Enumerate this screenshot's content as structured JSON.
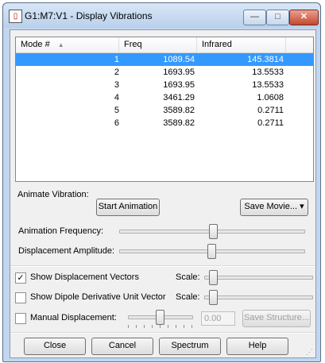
{
  "window": {
    "title": "G1:M7:V1 - Display Vibrations",
    "min_glyph": "—",
    "max_glyph": "□",
    "close_glyph": "✕"
  },
  "modes_table": {
    "columns": [
      "Mode #",
      "Freq",
      "Infrared"
    ],
    "sort_glyph": "▲",
    "selected_row": 0,
    "rows": [
      {
        "mode": "1",
        "freq": "1089.54",
        "ir": "145.3814"
      },
      {
        "mode": "2",
        "freq": "1693.95",
        "ir": "13.5533"
      },
      {
        "mode": "3",
        "freq": "1693.95",
        "ir": "13.5533"
      },
      {
        "mode": "4",
        "freq": "3461.29",
        "ir": "1.0608"
      },
      {
        "mode": "5",
        "freq": "3589.82",
        "ir": "0.2711"
      },
      {
        "mode": "6",
        "freq": "3589.82",
        "ir": "0.2711"
      }
    ]
  },
  "animate": {
    "label": "Animate Vibration:",
    "start_button": "Start Animation",
    "save_movie_button": "Save Movie...",
    "save_movie_glyph": "▾",
    "frequency_label": "Animation Frequency:",
    "frequency_level": 0.51,
    "amplitude_label": "Displacement Amplitude:",
    "amplitude_level": 0.5
  },
  "options": {
    "show_displacement": {
      "label": "Show Displacement Vectors",
      "checked": true,
      "scale_label": "Scale:",
      "scale_level": 0.05
    },
    "show_dipole": {
      "label": "Show Dipole Derivative Unit Vector",
      "checked": false,
      "scale_label": "Scale:",
      "scale_level": 0.05
    },
    "manual_displacement": {
      "label": "Manual Displacement:",
      "checked": false,
      "level": 0.5,
      "value": "0.00",
      "save_structure_button": "Save Structure..."
    },
    "check_glyph": "✓"
  },
  "buttons": {
    "close": "Close",
    "cancel": "Cancel",
    "spectrum": "Spectrum",
    "help": "Help"
  }
}
